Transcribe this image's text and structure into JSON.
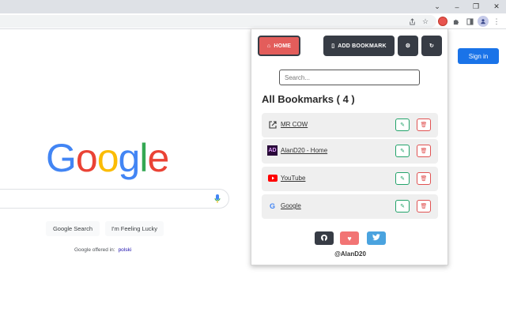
{
  "browser": {
    "window_controls": {
      "collapse": "⌄",
      "minimize": "–",
      "restore": "❐",
      "close": "✕"
    },
    "toolbar_icons": [
      "share-icon",
      "star-icon",
      "extension-badge-icon",
      "puzzle-icon",
      "sidepanel-icon",
      "profile-icon",
      "menu-icon"
    ]
  },
  "google": {
    "sign_in": "Sign in",
    "logo": {
      "letters": [
        "G",
        "o",
        "o",
        "g",
        "l",
        "e"
      ],
      "colors": [
        "#4285f4",
        "#ea4335",
        "#fbbc05",
        "#4285f4",
        "#34a853",
        "#ea4335"
      ]
    },
    "search_button": "Google Search",
    "lucky_button": "I'm Feeling Lucky",
    "offered_in": "Google offered in:",
    "language": "polski"
  },
  "popup": {
    "home_label": "HOME",
    "add_label": "ADD BOOKMARK",
    "search_placeholder": "Search...",
    "title": "All Bookmarks ( 4 )",
    "bookmarks": [
      {
        "label": "MR COW",
        "icon": "external-link-icon"
      },
      {
        "label": "AlanD20 - Home",
        "icon": "ad-logo-icon",
        "icon_text": "AD"
      },
      {
        "label": "YouTube",
        "icon": "youtube-icon"
      },
      {
        "label": "Google",
        "icon": "google-g-icon",
        "icon_text": "G"
      }
    ],
    "footer_buttons": [
      {
        "icon": "github-icon",
        "color": "#373c45"
      },
      {
        "icon": "heart-icon",
        "color": "#f27474"
      },
      {
        "icon": "twitter-icon",
        "color": "#4aa3df"
      }
    ],
    "credit": "@AlanD20"
  },
  "colors": {
    "accent_red": "#e35d5b",
    "dark_button": "#373c45",
    "edit_green": "#22a36a",
    "delete_red": "#e05252",
    "google_blue": "#1a73e8"
  }
}
